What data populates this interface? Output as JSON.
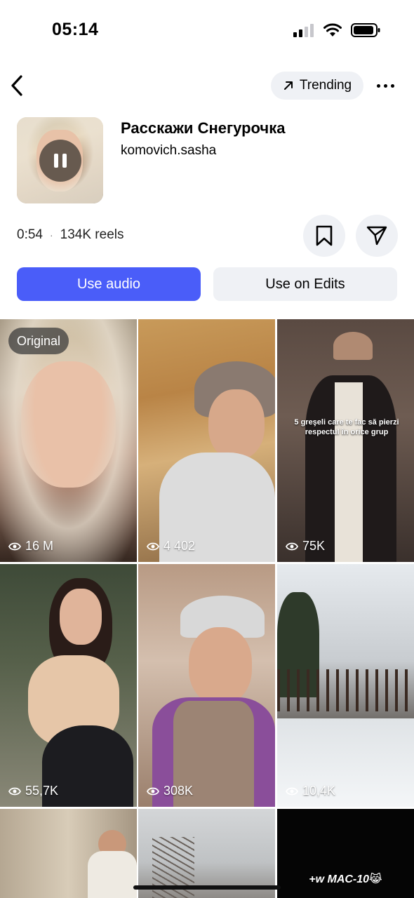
{
  "status_bar": {
    "time": "05:14"
  },
  "nav": {
    "trending_label": "Trending"
  },
  "audio": {
    "title": "Расскажи Снегурочка",
    "artist": "komovich.sasha",
    "duration": "0:54",
    "reels_count": "134K reels"
  },
  "actions": {
    "use_audio_label": "Use audio",
    "use_on_edits_label": "Use on Edits"
  },
  "reels": [
    {
      "views": "16 M",
      "badge": "Original"
    },
    {
      "views": "4 402"
    },
    {
      "views": "75K",
      "caption": "5 greşeli care te fac să pierzi respectul în orice grup"
    },
    {
      "views": "55,7K"
    },
    {
      "views": "308K"
    },
    {
      "views": "10,4K"
    },
    {},
    {},
    {
      "overlay_text": "+w MAC-10😹"
    }
  ],
  "colors": {
    "accent": "#4a5df9",
    "secondary_bg": "#eff1f5"
  }
}
